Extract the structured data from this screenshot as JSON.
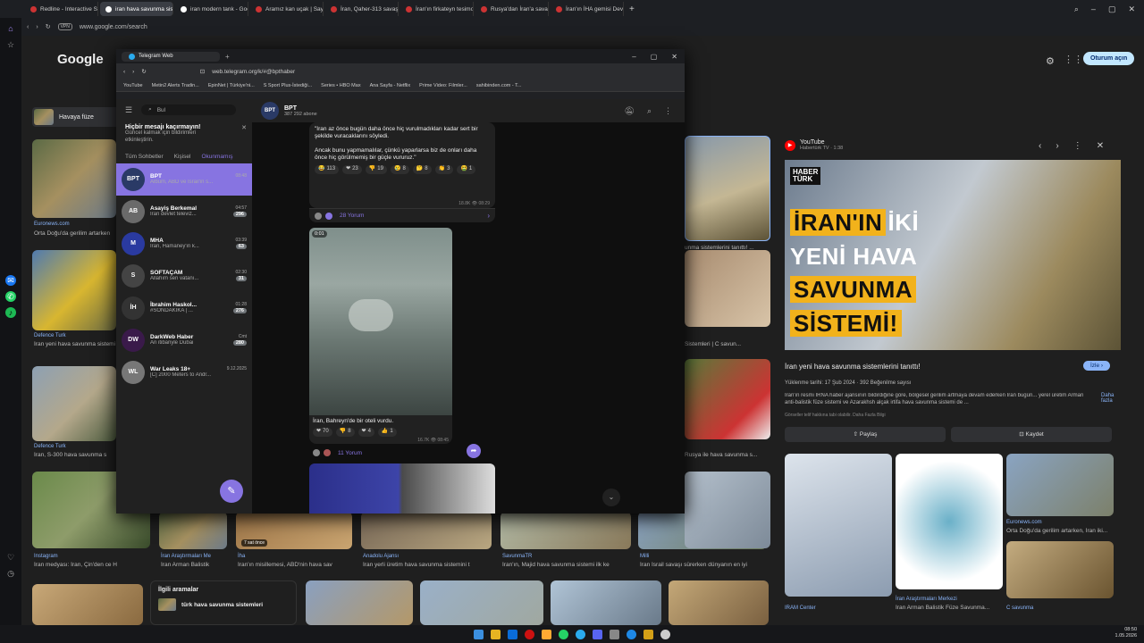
{
  "browser": {
    "tabs": [
      {
        "label": "Redline - Interactive Stori",
        "color": "#c33"
      },
      {
        "label": "iran hava savunma sistem",
        "color": "#fff",
        "active": true
      },
      {
        "label": "iran modern tank - Googl",
        "color": "#fff"
      },
      {
        "label": "Aramız kan uçak | Sayfa 4",
        "color": "#c33"
      },
      {
        "label": "İran, Qaher-313 savaş uç",
        "color": "#c33"
      },
      {
        "label": "İran'ın firkateyn tesimolo",
        "color": "#c33"
      },
      {
        "label": "Rusya'dan İran'a savaş uç",
        "color": "#c33"
      },
      {
        "label": "İran'ın İHA gemisi Dev",
        "color": "#c33"
      }
    ],
    "url": "www.google.com/search"
  },
  "google": {
    "logo": "Google",
    "signin": "Oturum açın",
    "filter_chip": "Havaya füze",
    "grid": [
      {
        "source": "Euronews.com",
        "caption": "Orta Doğu'da gerilim artarken"
      },
      {
        "source": "Defence Turk",
        "caption": "İran yeni hava savunma sistemi"
      },
      {
        "source": "Defence Turk",
        "caption": "İran, S-300 hava savunma s"
      },
      {
        "source": "Instagram",
        "caption": "İran medyası: İran, Çin'den ce H"
      },
      {
        "source": "İran Araştırmaları Me",
        "caption": "İran Arman Balistik"
      },
      {
        "source": "İha",
        "caption": "İran'ın misillemesi, ABD'nin hava sav"
      },
      {
        "source": "Anadolu Ajansı",
        "caption": "İran yerli üretim hava savunma sistemini t"
      },
      {
        "source": "SavunmaTR",
        "caption": "İran'ın, Majid hava savunma sistemi ilk ke"
      },
      {
        "source": "Milli",
        "caption": "İran İsrail savaşı sürerken dünyanın en iyi"
      }
    ],
    "right_captions": [
      "unma sistemlerini tanıttı! ...",
      "Sistemleri | C savun...",
      "Rusya ile hava savunma s..."
    ],
    "related_title": "İlgili aramalar",
    "related_item": "türk hava savunma sistemleri",
    "timestamp_label": "7 sat önce"
  },
  "panel": {
    "source": "YouTube",
    "sub": "Habertürk TV · 1:38",
    "logo_line1": "HABER",
    "logo_line2": "TÜRK",
    "headline": [
      "İRAN'IN",
      "İKİ",
      "YENİ HAVA",
      "SAVUNMA",
      "SİSTEMİ!"
    ],
    "title": "İran yeni hava savunma sistemlerini tanıttı!",
    "visit": "İzle",
    "meta": "Yüklenme tarihi: 17 Şub 2024 · 392 Beğenilme sayısı",
    "desc": "İran'ın resmi IRNA haber ajansının bildirdiğine göre, bölgesel gerilim artmaya devam ederken İran bugün... yerel üretim Arman anti-balistik füze sistemi ve Azarakhsh alçak irtifa hava savunma sistemi de ...",
    "desc_more": "Daha fazla",
    "note": "Görseller telif hakkına tabi olabilir. Daha Fazla Bilgi",
    "share": "Paylaş",
    "save": "Kaydet",
    "thumbs": [
      {
        "source": "IRAM Center",
        "caption": ""
      },
      {
        "source": "İran Araştırmaları Merkezi",
        "caption": "İran Arman Balistik Füze Savunma..."
      },
      {
        "source": "Euronews.com",
        "caption": "Orta Doğu'da gerilim artarken, İran iki..."
      },
      {
        "source": "C savunma",
        "caption": ""
      }
    ]
  },
  "telegram": {
    "tab_label": "Telegram Web",
    "url": "web.telegram.org/k/#@bpthaber",
    "bookmarks": [
      "YouTube",
      "Metin2 Alerts Tradin...",
      "EpinNet | Türkiye'ni...",
      "S Sport Plus-İstediği...",
      "Series • HBO Max",
      "Ana Sayfa - Netflix",
      "Prime Video: Filmler...",
      "sahibinden.com - T..."
    ],
    "search_placeholder": "Bul",
    "notice_title": "Hiçbir mesajı kaçırmayın!",
    "notice_body": "Güncel kalmak için bildirimleri etkinleştirin.",
    "filters": [
      "Tüm Sohbetler",
      "Kişisel",
      "Okunmamış"
    ],
    "chats": [
      {
        "name": "BPT",
        "msg": "Albüm, ABD ve İsrail'in s...",
        "time": "08:48",
        "badge": "",
        "avatar": "BPT",
        "color": "#2a3a66"
      },
      {
        "name": "Asayiş Berkemal",
        "msg": "İran devlet televiz...",
        "time": "04:57",
        "badge": "296",
        "avatar": "AB",
        "color": "#6a6a6a"
      },
      {
        "name": "MHA",
        "msg": "İran, Hamaney'in k...",
        "time": "03:39",
        "badge": "63",
        "avatar": "M",
        "color": "#2a3aa0"
      },
      {
        "name": "SOFTAÇAM",
        "msg": "Allahım sen vatanı...",
        "time": "02:30",
        "badge": "31",
        "avatar": "S",
        "color": "#444"
      },
      {
        "name": "İbrahim Haskol...",
        "msg": "#SONDAKİKA | ...",
        "time": "01:28",
        "badge": "276",
        "avatar": "İH",
        "color": "#333"
      },
      {
        "name": "DarkWeb Haber",
        "msg": "An itibariyle Dubai",
        "time": "Cmt",
        "badge": "280",
        "avatar": "DW",
        "color": "#3a1a4a"
      },
      {
        "name": "War Leaks 18+",
        "msg": "[C] 2000 Meters to Andr...",
        "time": "9.12.2025",
        "badge": "",
        "avatar": "WL",
        "color": "#777"
      }
    ],
    "channel_name": "BPT",
    "channel_subs": "387 292 abone",
    "msg1_text1": "\"İran az önce bugün daha önce hiç vurulmadıkları kadar sert bir şekilde vuracaklarını söyledi.",
    "msg1_text2": "Ancak bunu yapmamalılar, çünkü yaparlarsa biz de onları daha önce hiç görülmemiş bir güçle vururuz.\"",
    "msg1_reacts": [
      "113",
      "23",
      "19",
      "8",
      "8",
      "3",
      "1"
    ],
    "msg1_views": "18.8K",
    "msg1_time": "08:29",
    "msg1_comments": "28 Yorum",
    "video_duration": "0:01",
    "msg2_text": "İran, Bahreyn'de bir oteli vurdu.",
    "msg2_reacts": [
      "70",
      "8",
      "4",
      "1"
    ],
    "msg2_views": "16.7K",
    "msg2_time": "08:45",
    "msg2_comments": "11 Yorum"
  },
  "taskbar": {
    "time": "08:50",
    "date": "1.05.2026"
  }
}
